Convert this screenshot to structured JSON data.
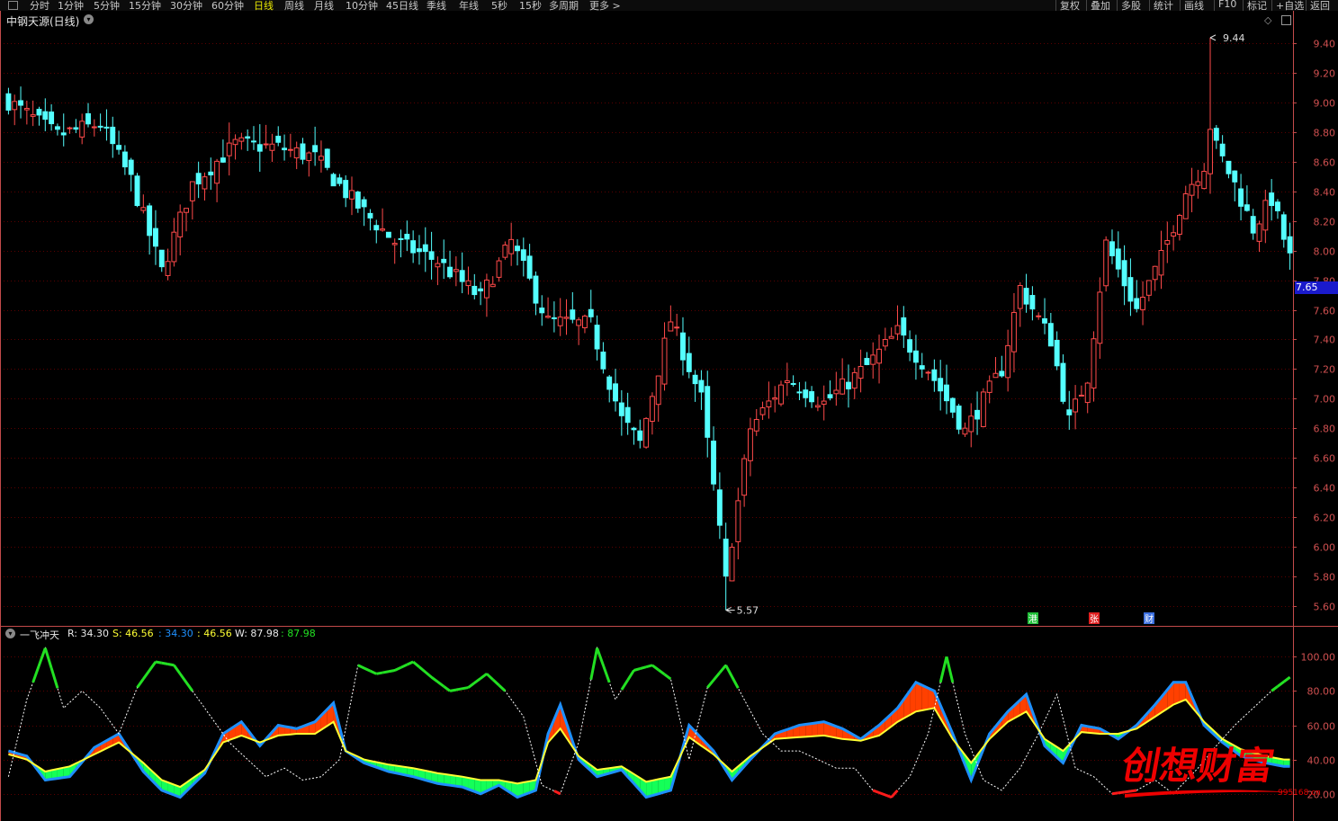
{
  "toolbar": {
    "periods": [
      "分时",
      "1分钟",
      "5分钟",
      "15分钟",
      "30分钟",
      "60分钟",
      "日线",
      "周线",
      "月线",
      "10分钟",
      "45日线",
      "季线",
      "年线",
      "5秒",
      "15秒",
      "多周期",
      "更多 >"
    ],
    "active_index": 6,
    "right_items": [
      "复权",
      "叠加",
      "多股",
      "统计",
      "画线",
      "F10",
      "标记",
      "+自选",
      "返回"
    ]
  },
  "main_panel": {
    "stock_title": "中钢天源(日线)",
    "current_price_label": "7.65",
    "high_marker": "9.44",
    "low_marker": "5.57",
    "badges": [
      {
        "text": "港",
        "color": "#22c03a"
      },
      {
        "text": "张",
        "color": "#e02020"
      },
      {
        "text": "财",
        "color": "#3b6fe0"
      }
    ]
  },
  "indicator_panel": {
    "name": "一飞冲天",
    "r_label": "R: 34.30",
    "s_label": "S: 46.56",
    "v1": ": 34.30",
    "v2": ": 46.56",
    "w_label": "W: 87.98",
    "v3": ": 87.98"
  },
  "watermark": {
    "text": "创想财富",
    "url": "995168.cn"
  },
  "colors": {
    "up": "#ff4a4a",
    "down": "#54ffff",
    "grid": "#5a0000",
    "axis": "#c24a4a",
    "R": "#1e90ff",
    "S": "#ffff33",
    "W": "#ffffff",
    "fill_up": "#ff4000",
    "fill_down": "#14ff58",
    "W_hi": "#22e022",
    "W_lo": "#ff1a1a"
  },
  "chart_data": [
    {
      "type": "candlestick",
      "ylim": [
        5.5,
        9.5
      ],
      "y_ticks": [
        9.4,
        9.2,
        9.0,
        8.8,
        8.6,
        8.4,
        8.2,
        8.0,
        7.8,
        7.6,
        7.4,
        7.2,
        7.0,
        6.8,
        6.6,
        6.4,
        6.2,
        6.0,
        5.8,
        5.6
      ],
      "close_anchors": [
        [
          0,
          9.01
        ],
        [
          8,
          8.78
        ],
        [
          15,
          8.86
        ],
        [
          20,
          8.48
        ],
        [
          25,
          7.86
        ],
        [
          30,
          8.45
        ],
        [
          37,
          8.72
        ],
        [
          44,
          8.7
        ],
        [
          50,
          8.63
        ],
        [
          57,
          8.3
        ],
        [
          63,
          8.06
        ],
        [
          70,
          7.93
        ],
        [
          77,
          7.68
        ],
        [
          82,
          8.06
        ],
        [
          88,
          7.52
        ],
        [
          95,
          7.5
        ],
        [
          100,
          6.86
        ],
        [
          103,
          6.7
        ],
        [
          108,
          7.53
        ],
        [
          113,
          7.0
        ],
        [
          117,
          5.8
        ],
        [
          121,
          6.8
        ],
        [
          127,
          7.14
        ],
        [
          133,
          6.97
        ],
        [
          140,
          7.22
        ],
        [
          145,
          7.45
        ],
        [
          150,
          7.2
        ],
        [
          156,
          6.78
        ],
        [
          162,
          7.2
        ],
        [
          165,
          7.75
        ],
        [
          170,
          7.4
        ],
        [
          173,
          6.85
        ],
        [
          176,
          7.15
        ],
        [
          179,
          8.05
        ],
        [
          184,
          7.6
        ],
        [
          188,
          7.95
        ],
        [
          192,
          8.4
        ],
        [
          197,
          8.7
        ],
        [
          200,
          8.45
        ],
        [
          203,
          8.15
        ],
        [
          206,
          8.35
        ],
        [
          209,
          7.95
        ]
      ],
      "high_point": {
        "index": 196,
        "value": 9.44
      },
      "low_point": {
        "index": 117,
        "value": 5.57
      }
    },
    {
      "type": "line",
      "ylim": [
        12,
        108
      ],
      "y_ticks": [
        100.0,
        80.0,
        60.0,
        40.0,
        20.0
      ],
      "series": [
        {
          "name": "R",
          "anchors": [
            [
              0,
              45
            ],
            [
              3,
              42
            ],
            [
              6,
              28
            ],
            [
              10,
              30
            ],
            [
              14,
              47
            ],
            [
              18,
              55
            ],
            [
              22,
              33
            ],
            [
              25,
              22
            ],
            [
              28,
              18
            ],
            [
              32,
              32
            ],
            [
              35,
              55
            ],
            [
              38,
              62
            ],
            [
              41,
              48
            ],
            [
              44,
              60
            ],
            [
              47,
              58
            ],
            [
              50,
              62
            ],
            [
              53,
              73
            ],
            [
              55,
              45
            ],
            [
              58,
              38
            ],
            [
              62,
              33
            ],
            [
              66,
              30
            ],
            [
              70,
              26
            ],
            [
              74,
              24
            ],
            [
              77,
              20
            ],
            [
              80,
              25
            ],
            [
              83,
              18
            ],
            [
              86,
              22
            ],
            [
              88,
              55
            ],
            [
              90,
              72
            ],
            [
              93,
              40
            ],
            [
              96,
              30
            ],
            [
              100,
              34
            ],
            [
              104,
              18
            ],
            [
              108,
              22
            ],
            [
              111,
              60
            ],
            [
              115,
              45
            ],
            [
              118,
              28
            ],
            [
              121,
              40
            ],
            [
              125,
              55
            ],
            [
              129,
              60
            ],
            [
              133,
              62
            ],
            [
              136,
              58
            ],
            [
              139,
              52
            ],
            [
              142,
              60
            ],
            [
              145,
              70
            ],
            [
              148,
              85
            ],
            [
              151,
              80
            ],
            [
              154,
              55
            ],
            [
              157,
              28
            ],
            [
              160,
              55
            ],
            [
              163,
              68
            ],
            [
              166,
              78
            ],
            [
              169,
              48
            ],
            [
              172,
              38
            ],
            [
              175,
              60
            ],
            [
              178,
              58
            ],
            [
              181,
              52
            ],
            [
              184,
              60
            ],
            [
              187,
              72
            ],
            [
              190,
              85
            ],
            [
              192,
              85
            ],
            [
              195,
              60
            ],
            [
              198,
              50
            ],
            [
              201,
              42
            ],
            [
              205,
              38
            ],
            [
              208,
              36
            ]
          ]
        },
        {
          "name": "S",
          "anchors": [
            [
              0,
              43
            ],
            [
              3,
              40
            ],
            [
              6,
              33
            ],
            [
              10,
              36
            ],
            [
              14,
              43
            ],
            [
              18,
              50
            ],
            [
              22,
              38
            ],
            [
              25,
              28
            ],
            [
              28,
              24
            ],
            [
              32,
              34
            ],
            [
              35,
              50
            ],
            [
              38,
              54
            ],
            [
              41,
              50
            ],
            [
              44,
              54
            ],
            [
              47,
              55
            ],
            [
              50,
              55
            ],
            [
              53,
              62
            ],
            [
              55,
              45
            ],
            [
              58,
              40
            ],
            [
              62,
              37
            ],
            [
              66,
              35
            ],
            [
              70,
              32
            ],
            [
              74,
              30
            ],
            [
              77,
              28
            ],
            [
              80,
              28
            ],
            [
              83,
              26
            ],
            [
              86,
              28
            ],
            [
              88,
              50
            ],
            [
              90,
              58
            ],
            [
              93,
              42
            ],
            [
              96,
              34
            ],
            [
              100,
              36
            ],
            [
              104,
              27
            ],
            [
              108,
              30
            ],
            [
              111,
              53
            ],
            [
              115,
              43
            ],
            [
              118,
              33
            ],
            [
              121,
              42
            ],
            [
              125,
              52
            ],
            [
              129,
              53
            ],
            [
              133,
              54
            ],
            [
              136,
              52
            ],
            [
              139,
              51
            ],
            [
              142,
              54
            ],
            [
              145,
              62
            ],
            [
              148,
              68
            ],
            [
              151,
              70
            ],
            [
              154,
              52
            ],
            [
              157,
              38
            ],
            [
              160,
              52
            ],
            [
              163,
              62
            ],
            [
              166,
              68
            ],
            [
              169,
              52
            ],
            [
              172,
              45
            ],
            [
              175,
              56
            ],
            [
              178,
              55
            ],
            [
              181,
              55
            ],
            [
              184,
              58
            ],
            [
              187,
              65
            ],
            [
              190,
              72
            ],
            [
              192,
              75
            ],
            [
              195,
              62
            ],
            [
              198,
              52
            ],
            [
              201,
              46
            ],
            [
              205,
              42
            ],
            [
              208,
              40
            ]
          ]
        },
        {
          "name": "W",
          "anchors": [
            [
              0,
              30
            ],
            [
              3,
              75
            ],
            [
              6,
              105
            ],
            [
              9,
              70
            ],
            [
              12,
              80
            ],
            [
              15,
              70
            ],
            [
              18,
              55
            ],
            [
              21,
              82
            ],
            [
              24,
              97
            ],
            [
              27,
              95
            ],
            [
              30,
              80
            ],
            [
              33,
              65
            ],
            [
              36,
              50
            ],
            [
              39,
              40
            ],
            [
              42,
              30
            ],
            [
              45,
              35
            ],
            [
              48,
              28
            ],
            [
              51,
              30
            ],
            [
              54,
              40
            ],
            [
              57,
              95
            ],
            [
              60,
              90
            ],
            [
              63,
              92
            ],
            [
              66,
              97
            ],
            [
              69,
              88
            ],
            [
              72,
              80
            ],
            [
              75,
              82
            ],
            [
              78,
              90
            ],
            [
              81,
              80
            ],
            [
              84,
              65
            ],
            [
              87,
              25
            ],
            [
              90,
              20
            ],
            [
              93,
              50
            ],
            [
              96,
              105
            ],
            [
              99,
              75
            ],
            [
              102,
              92
            ],
            [
              105,
              95
            ],
            [
              108,
              87
            ],
            [
              111,
              40
            ],
            [
              114,
              82
            ],
            [
              117,
              95
            ],
            [
              120,
              75
            ],
            [
              123,
              55
            ],
            [
              126,
              45
            ],
            [
              129,
              45
            ],
            [
              132,
              40
            ],
            [
              135,
              35
            ],
            [
              138,
              35
            ],
            [
              141,
              22
            ],
            [
              144,
              18
            ],
            [
              147,
              30
            ],
            [
              150,
              55
            ],
            [
              153,
              100
            ],
            [
              156,
              55
            ],
            [
              159,
              28
            ],
            [
              162,
              22
            ],
            [
              165,
              35
            ],
            [
              168,
              55
            ],
            [
              171,
              78
            ],
            [
              174,
              35
            ],
            [
              177,
              30
            ],
            [
              180,
              20
            ],
            [
              184,
              22
            ],
            [
              187,
              28
            ],
            [
              190,
              20
            ],
            [
              194,
              35
            ],
            [
              197,
              48
            ],
            [
              200,
              60
            ],
            [
              203,
              70
            ],
            [
              206,
              80
            ],
            [
              209,
              88
            ]
          ]
        }
      ]
    }
  ]
}
